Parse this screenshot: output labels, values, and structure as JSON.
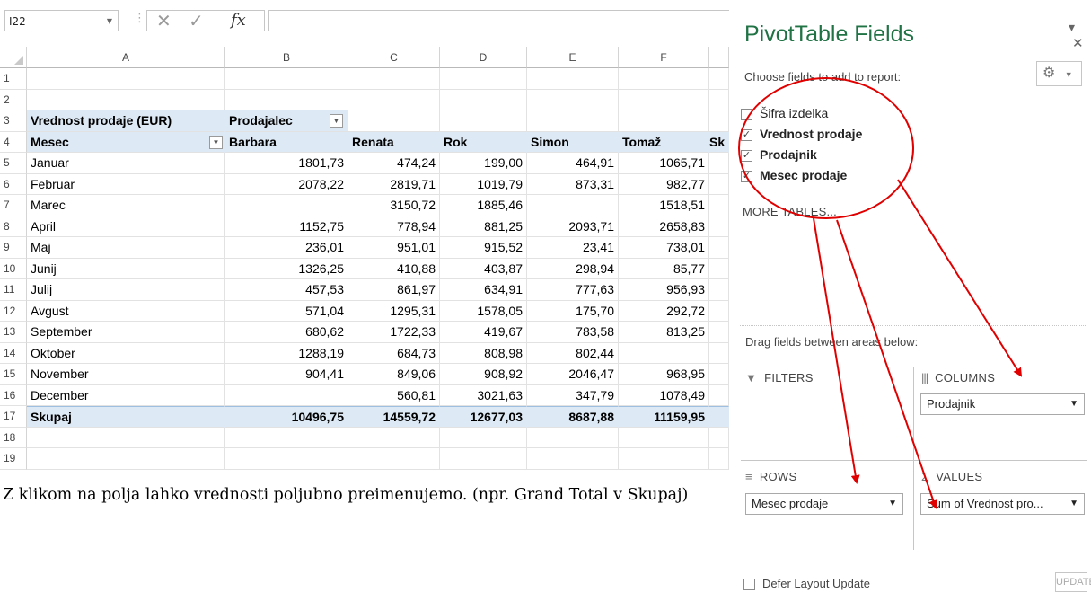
{
  "formula_bar": {
    "name_box": "I22",
    "fx_label": "fx",
    "formula": ""
  },
  "columns": [
    "A",
    "B",
    "C",
    "D",
    "E",
    "F"
  ],
  "rows": [
    {
      "n": "1",
      "a": "",
      "v": [
        "",
        "",
        "",
        "",
        ""
      ]
    },
    {
      "n": "2",
      "a": "",
      "v": [
        "",
        "",
        "",
        "",
        ""
      ]
    },
    {
      "n": "3",
      "a": "Vrednost prodaje (EUR)",
      "v": [
        "Prodajalec",
        "",
        "",
        "",
        ""
      ]
    },
    {
      "n": "4",
      "a": "Mesec",
      "v": [
        "Barbara",
        "Renata",
        "Rok",
        "Simon",
        "Tomaž"
      ]
    },
    {
      "n": "5",
      "a": "Januar",
      "v": [
        "1801,73",
        "474,24",
        "199,00",
        "464,91",
        "1065,71"
      ]
    },
    {
      "n": "6",
      "a": "Februar",
      "v": [
        "2078,22",
        "2819,71",
        "1019,79",
        "873,31",
        "982,77"
      ]
    },
    {
      "n": "7",
      "a": "Marec",
      "v": [
        "",
        "3150,72",
        "1885,46",
        "",
        "1518,51"
      ]
    },
    {
      "n": "8",
      "a": "April",
      "v": [
        "1152,75",
        "778,94",
        "881,25",
        "2093,71",
        "2658,83"
      ]
    },
    {
      "n": "9",
      "a": "Maj",
      "v": [
        "236,01",
        "951,01",
        "915,52",
        "23,41",
        "738,01"
      ]
    },
    {
      "n": "10",
      "a": "Junij",
      "v": [
        "1326,25",
        "410,88",
        "403,87",
        "298,94",
        "85,77"
      ]
    },
    {
      "n": "11",
      "a": "Julij",
      "v": [
        "457,53",
        "861,97",
        "634,91",
        "777,63",
        "956,93"
      ]
    },
    {
      "n": "12",
      "a": "Avgust",
      "v": [
        "571,04",
        "1295,31",
        "1578,05",
        "175,70",
        "292,72"
      ]
    },
    {
      "n": "13",
      "a": "September",
      "v": [
        "680,62",
        "1722,33",
        "419,67",
        "783,58",
        "813,25"
      ]
    },
    {
      "n": "14",
      "a": "Oktober",
      "v": [
        "1288,19",
        "684,73",
        "808,98",
        "802,44",
        ""
      ]
    },
    {
      "n": "15",
      "a": "November",
      "v": [
        "904,41",
        "849,06",
        "908,92",
        "2046,47",
        "968,95"
      ]
    },
    {
      "n": "16",
      "a": "December",
      "v": [
        "",
        "560,81",
        "3021,63",
        "347,79",
        "1078,49"
      ]
    },
    {
      "n": "17",
      "a": "Skupaj",
      "v": [
        "10496,75",
        "14559,72",
        "12677,03",
        "8687,88",
        "11159,95"
      ]
    },
    {
      "n": "18",
      "a": "",
      "v": [
        "",
        "",
        "",
        "",
        ""
      ]
    },
    {
      "n": "19",
      "a": "",
      "v": [
        "",
        "",
        "",
        "",
        ""
      ]
    }
  ],
  "overflow_g4": "Sk",
  "caption": "Z klikom na polja lahko vrednosti poljubno preimenujemo. (npr. Grand Total v Skupaj)",
  "pane": {
    "title": "PivotTable Fields",
    "choose_label": "Choose fields to add to report:",
    "fields": [
      {
        "label": "Šifra izdelka",
        "checked": false
      },
      {
        "label": "Vrednost prodaje",
        "checked": true
      },
      {
        "label": "Prodajnik",
        "checked": true
      },
      {
        "label": "Mesec prodaje",
        "checked": true
      }
    ],
    "more_tables": "MORE TABLES...",
    "drag_label": "Drag fields between areas below:",
    "filters_label": "FILTERS",
    "columns_label": "COLUMNS",
    "rows_label": "ROWS",
    "values_label": "VALUES",
    "columns_field": "Prodajnik",
    "rows_field": "Mesec prodaje",
    "values_field": "Sum of Vrednost pro...",
    "defer_label": "Defer Layout Update",
    "update_label": "UPDATE"
  },
  "annotation_color": "#e00000"
}
